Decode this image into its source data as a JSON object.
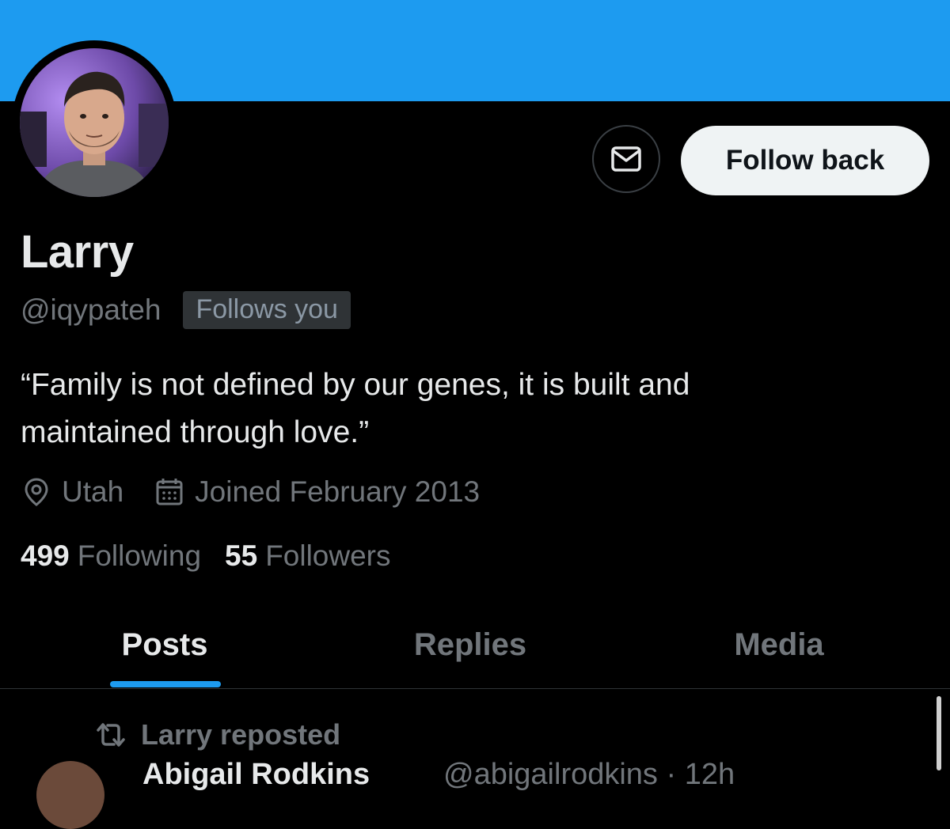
{
  "profile": {
    "display_name": "Larry",
    "handle": "@iqypateh",
    "follows_you_badge": "Follows you",
    "bio_line1": "“Family is not defined by our genes, it is built and",
    "bio_line2": "maintained through love.”",
    "location": "Utah",
    "joined": "Joined February 2013",
    "following_count": "499",
    "following_label": "Following",
    "followers_count": "55",
    "followers_label": "Followers"
  },
  "actions": {
    "follow_back_label": "Follow back",
    "message_icon": "envelope-icon"
  },
  "tabs": [
    {
      "label": "Posts",
      "active": true
    },
    {
      "label": "Replies",
      "active": false
    },
    {
      "label": "Media",
      "active": false
    }
  ],
  "feed": {
    "repost_label": "Larry reposted",
    "repost_icon": "repost-icon",
    "next_author": "Abigail Rodkins",
    "next_handle": "@abigailrodkins · 12h"
  },
  "colors": {
    "banner": "#1d9bf0",
    "accent": "#1d9bf0",
    "background": "#000000",
    "primary_text": "#e7e9ea",
    "secondary_text": "#71767b"
  }
}
